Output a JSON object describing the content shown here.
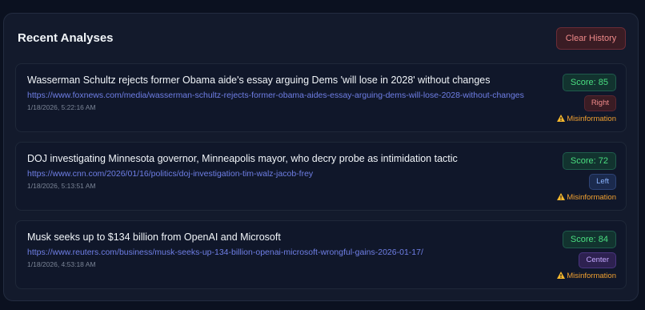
{
  "header": {
    "title": "Recent Analyses",
    "clear_label": "Clear History"
  },
  "analyses": [
    {
      "title": "Wasserman Schultz rejects former Obama aide's essay arguing Dems 'will lose in 2028' without changes",
      "url": "https://www.foxnews.com/media/wasserman-schultz-rejects-former-obama-aides-essay-arguing-dems-will-lose-2028-without-changes",
      "date": "1/18/2026, 5:22:16 AM",
      "score": "Score: 85",
      "bias": "Right",
      "flag": "Misinformation"
    },
    {
      "title": "DOJ investigating Minnesota governor, Minneapolis mayor, who decry probe as intimidation tactic",
      "url": "https://www.cnn.com/2026/01/16/politics/doj-investigation-tim-walz-jacob-frey",
      "date": "1/18/2026, 5:13:51 AM",
      "score": "Score: 72",
      "bias": "Left",
      "flag": "Misinformation"
    },
    {
      "title": "Musk seeks up to $134 billion from OpenAI and Microsoft",
      "url": "https://www.reuters.com/business/musk-seeks-up-134-billion-openai-microsoft-wrongful-gains-2026-01-17/",
      "date": "1/18/2026, 4:53:18 AM",
      "score": "Score: 84",
      "bias": "Center",
      "flag": "Misinformation"
    }
  ],
  "colors": {
    "background": "#0b1120",
    "panel": "#131a2c",
    "card": "#10172a",
    "score_text": "#4ade80",
    "link": "#6f7fe6",
    "warning": "#f0a030"
  },
  "icons": {
    "flag_icon": "warning-icon"
  }
}
